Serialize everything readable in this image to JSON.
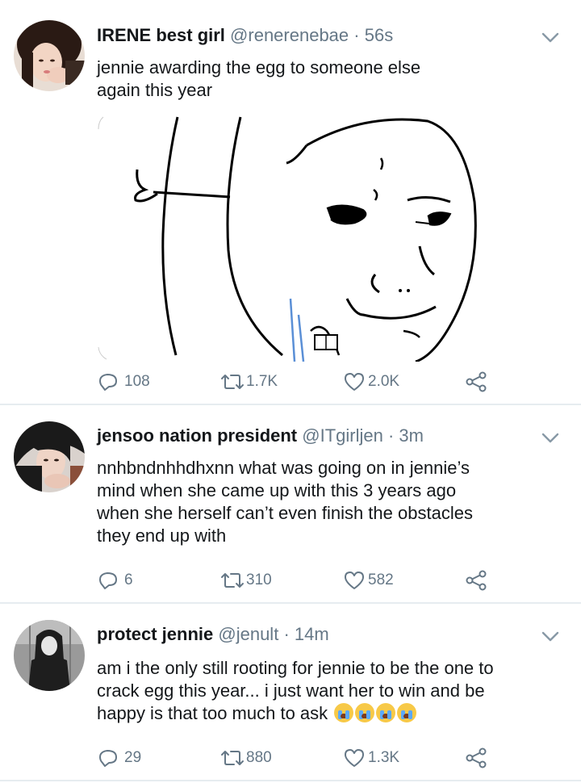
{
  "tweets": [
    {
      "name": "IRENE best girl",
      "handle": "@renerenebae",
      "time": "· 56s",
      "text": "jennie awarding the egg to someone else\nagain this year",
      "has_media": true,
      "media_desc_icon": "meme-face-image",
      "reply_count": "108",
      "retweet_count": "1.7K",
      "like_count": "2.0K"
    },
    {
      "name": "jensoo nation president",
      "handle": "@ITgirljen",
      "time": "· 3m",
      "text": "nnhbndnhhdhxnn what was going on in jennie’s\nmind when she came up with this 3 years ago\nwhen she herself can’t even finish the obstacles\nthey end up with",
      "reply_count": "6",
      "retweet_count": "310",
      "like_count": "582"
    },
    {
      "name": "protect jennie",
      "handle": "@jenult",
      "time": "· 14m",
      "text": "am i the only still rooting for jennie to be the one to\ncrack egg this year... i just want her to win and be\nhappy is that too much to ask ",
      "emoji": "loudly-crying-face",
      "emoji_count": 4,
      "reply_count": "29",
      "retweet_count": "880",
      "like_count": "1.3K"
    }
  ],
  "colors": {
    "text": "#14171a",
    "secondary": "#657786",
    "divider": "#e6ecf0",
    "chevron": "#8899a6"
  }
}
